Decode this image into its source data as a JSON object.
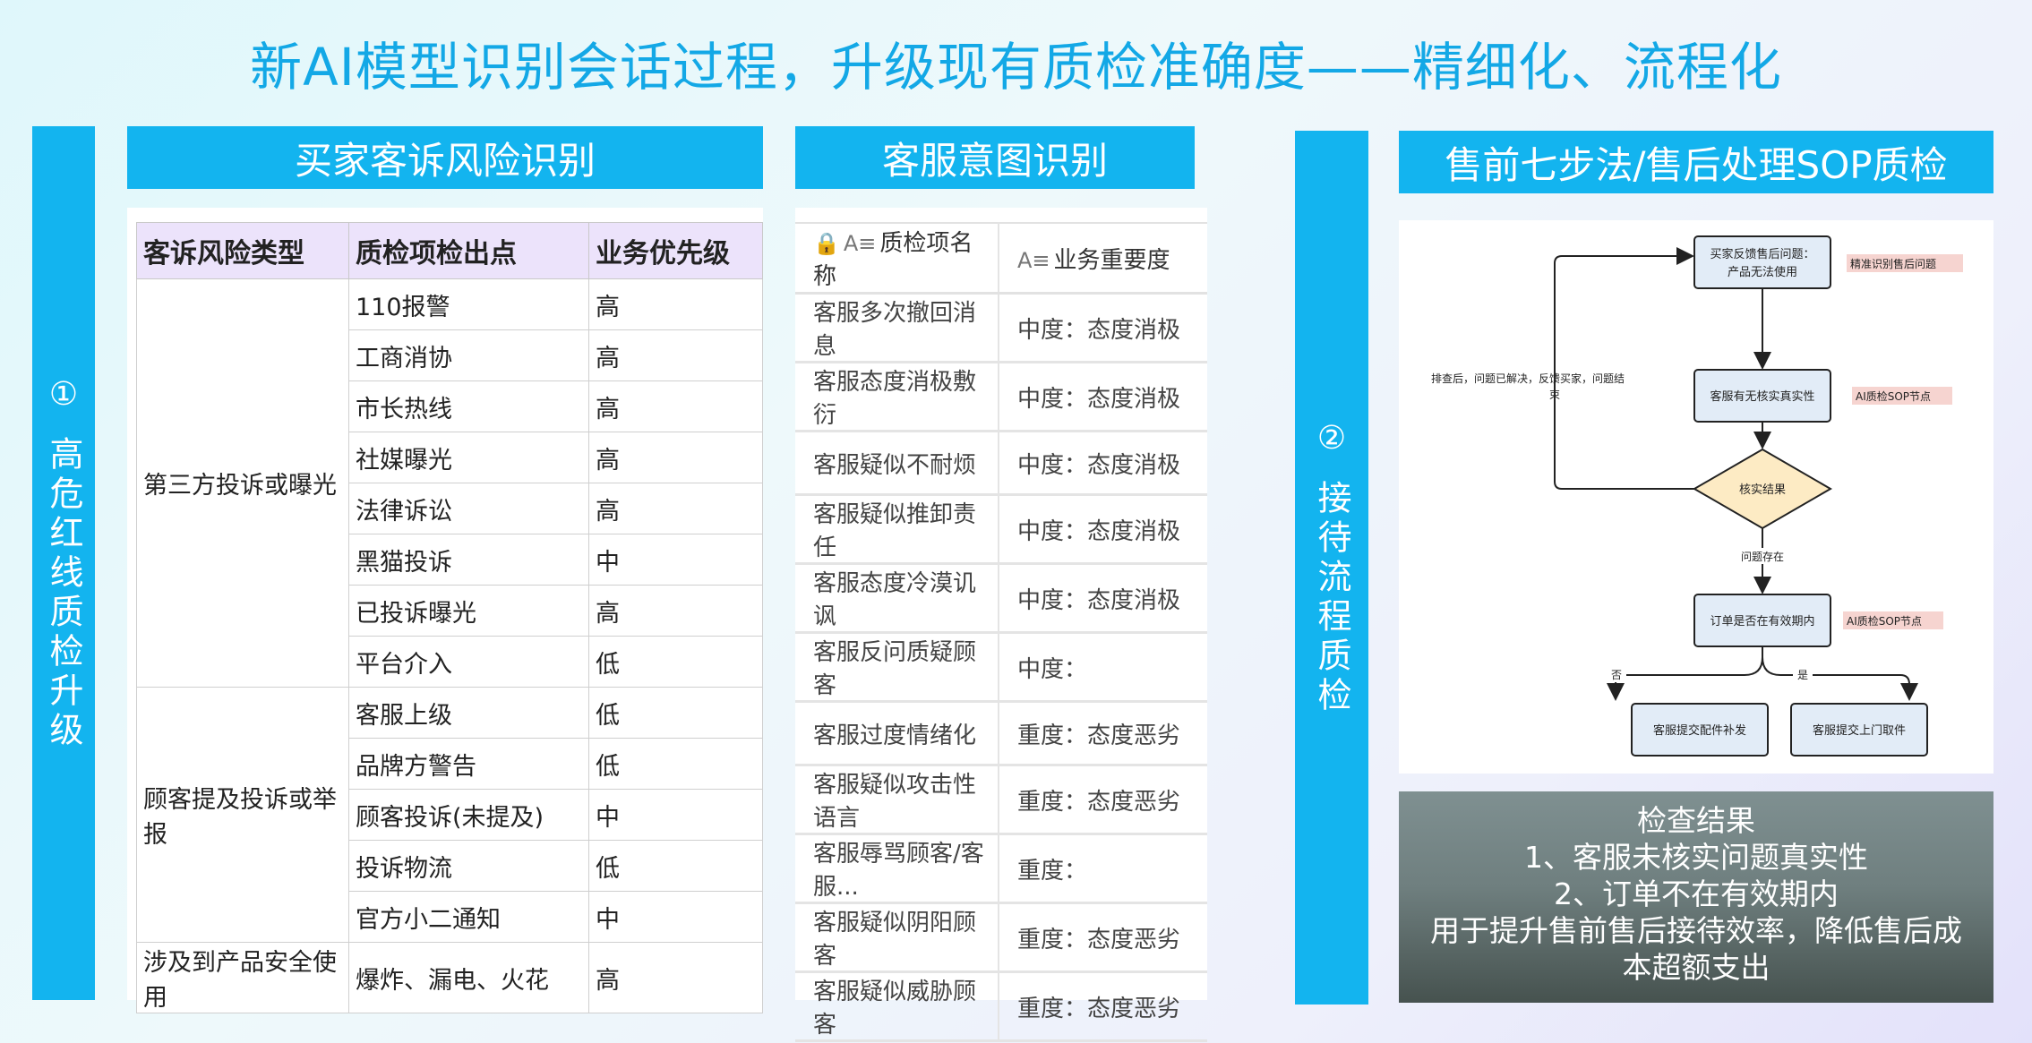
{
  "title": "新AI模型识别会话过程，升级现有质检准确度——精细化、流程化",
  "left_bar": {
    "num": "①",
    "text": "高危红线质检升级"
  },
  "mid_bar": {
    "num": "②",
    "text": "接待流程质检"
  },
  "complaint": {
    "header": "买家客诉风险识别",
    "columns": [
      "客诉风险类型",
      "质检项检出点",
      "业务优先级"
    ],
    "groups": [
      {
        "type": "第三方投诉或曝光",
        "rows": [
          {
            "item": "110报警",
            "priority": "高"
          },
          {
            "item": "工商消协",
            "priority": "高"
          },
          {
            "item": "市长热线",
            "priority": "高"
          },
          {
            "item": "社媒曝光",
            "priority": "高"
          },
          {
            "item": "法律诉讼",
            "priority": "高"
          },
          {
            "item": "黑猫投诉",
            "priority": "中"
          },
          {
            "item": "已投诉曝光",
            "priority": "高"
          },
          {
            "item": "平台介入",
            "priority": "低"
          }
        ]
      },
      {
        "type": "顾客提及投诉或举报",
        "rows": [
          {
            "item": "客服上级",
            "priority": "低"
          },
          {
            "item": "品牌方警告",
            "priority": "低"
          },
          {
            "item": "顾客投诉(未提及)",
            "priority": "中"
          },
          {
            "item": "投诉物流",
            "priority": "低"
          },
          {
            "item": "官方小二通知",
            "priority": "中"
          }
        ]
      },
      {
        "type": "涉及到产品安全使用",
        "rows": [
          {
            "item": "爆炸、漏电、火花",
            "priority": "高"
          }
        ]
      }
    ]
  },
  "intent": {
    "header": "客服意图识别",
    "col_icon": "A≡",
    "columns": [
      "质检项名称",
      "业务重要度"
    ],
    "rows": [
      {
        "name": "客服多次撤回消息",
        "level": "中度：态度消极"
      },
      {
        "name": "客服态度消极敷衍",
        "level": "中度：态度消极"
      },
      {
        "name": "客服疑似不耐烦",
        "level": "中度：态度消极"
      },
      {
        "name": "客服疑似推卸责任",
        "level": "中度：态度消极"
      },
      {
        "name": "客服态度冷漠讥讽",
        "level": "中度：态度消极"
      },
      {
        "name": "客服反问质疑顾客",
        "level": "中度："
      },
      {
        "name": "客服过度情绪化",
        "level": "重度：态度恶劣"
      },
      {
        "name": "客服疑似攻击性语言",
        "level": "重度：态度恶劣"
      },
      {
        "name": "客服辱骂顾客/客服...",
        "level": "重度："
      },
      {
        "name": "客服疑似阴阳顾客",
        "level": "重度：态度恶劣"
      },
      {
        "name": "客服疑似威胁顾客",
        "level": "重度：态度恶劣"
      }
    ]
  },
  "sop": {
    "header": "售前七步法/售后处理SOP质检",
    "flow": {
      "start_line1": "买家反馈售后问题：",
      "start_line2": "产品无法使用",
      "tag_precise": "精准识别售后问题",
      "verify": "客服有无核实真实性",
      "tag_sop1": "AI质检SOP节点",
      "decision": "核实结果",
      "loop_line1": "排查后，问题已解决，反馈买家，问题结",
      "loop_line2": "束",
      "exists": "问题存在",
      "order_check": "订单是否在有效期内",
      "tag_sop2": "AI质检SOP节点",
      "no": "否",
      "yes": "是",
      "left_out": "客服提交配件补发",
      "right_out": "客服提交上门取件"
    }
  },
  "result": {
    "title": "检查结果",
    "line1": "1、客服未核实问题真实性",
    "line2": "2、订单不在有效期内",
    "line3": "用于提升售前售后接待效率，降低售后成",
    "line4": "本超额支出"
  },
  "colors": {
    "accent": "#13b4ef",
    "title": "#13a8e6",
    "table_header": "#ece3fb",
    "decision": "#fdebc4",
    "tag": "#f6d4d0"
  }
}
